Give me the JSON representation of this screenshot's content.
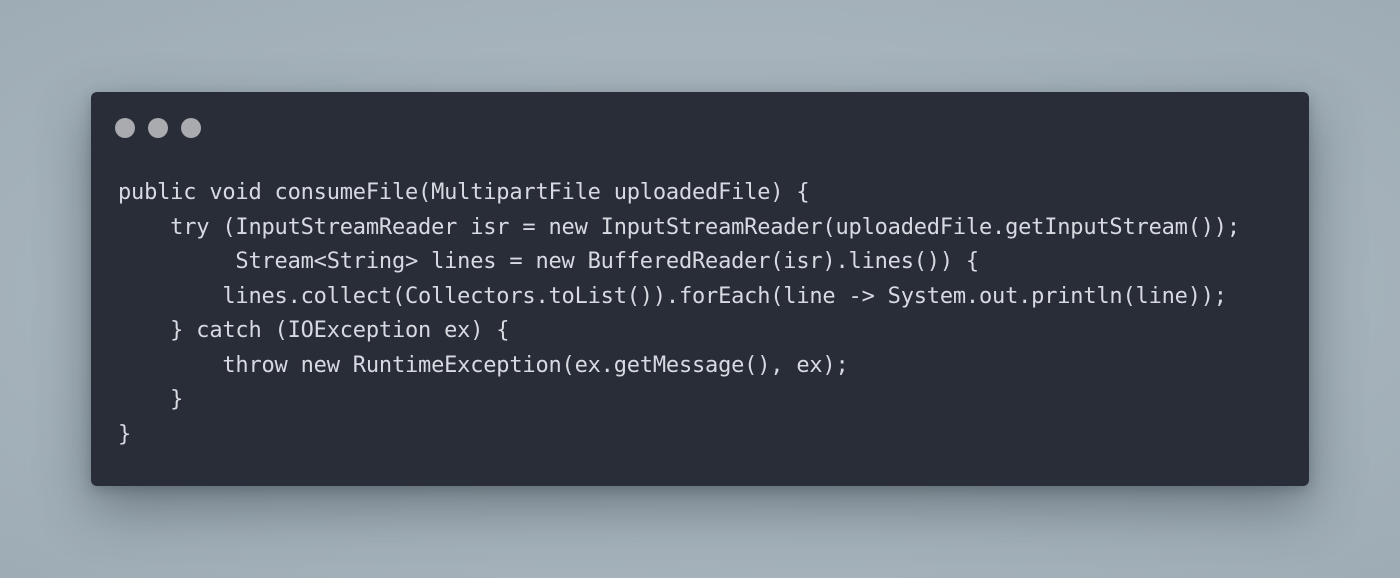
{
  "window": {
    "background_color": "#292d38",
    "page_background_color": "#a7b4bd",
    "traffic_lights": [
      {
        "name": "close-dot",
        "color": "#a9abaf"
      },
      {
        "name": "minimize-dot",
        "color": "#a9abaf"
      },
      {
        "name": "zoom-dot",
        "color": "#a9abaf"
      }
    ]
  },
  "code": {
    "language": "java",
    "text_color": "#d7dae0",
    "lines": [
      "public void consumeFile(MultipartFile uploadedFile) {",
      "    try (InputStreamReader isr = new InputStreamReader(uploadedFile.getInputStream());",
      "         Stream<String> lines = new BufferedReader(isr).lines()) {",
      "        lines.collect(Collectors.toList()).forEach(line -> System.out.println(line));",
      "    } catch (IOException ex) {",
      "        throw new RuntimeException(ex.getMessage(), ex);",
      "    }",
      "}"
    ]
  }
}
